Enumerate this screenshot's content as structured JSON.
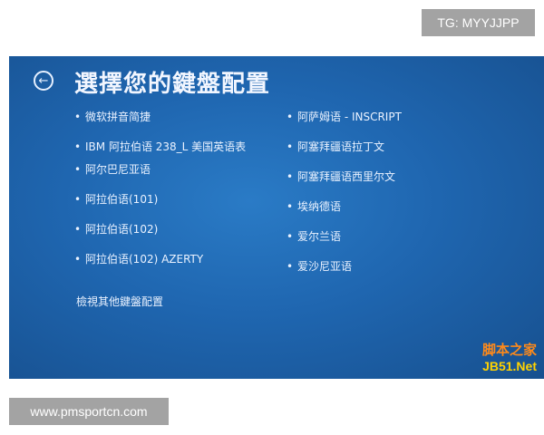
{
  "tg_badge": "TG: MYYJJPP",
  "site_badge": "www.pmsportcn.com",
  "screen": {
    "title": "選擇您的鍵盤配置",
    "back_icon": "back-arrow-circle-icon",
    "left_items": [
      "微软拼音简捷",
      "IBM 阿拉伯语 238_L 美国英语表",
      "阿尔巴尼亚语",
      "阿拉伯语(101)",
      "阿拉伯语(102)",
      "阿拉伯语(102) AZERTY"
    ],
    "right_items": [
      "阿萨姆语 - INSCRIPT",
      "阿塞拜疆语拉丁文",
      "阿塞拜疆语西里尔文",
      "埃纳德语",
      "爱尔兰语",
      "爱沙尼亚语"
    ],
    "more_link": "檢視其他鍵盤配置"
  },
  "watermark": {
    "top": "脚本之家",
    "bottom": "JB51.Net"
  }
}
